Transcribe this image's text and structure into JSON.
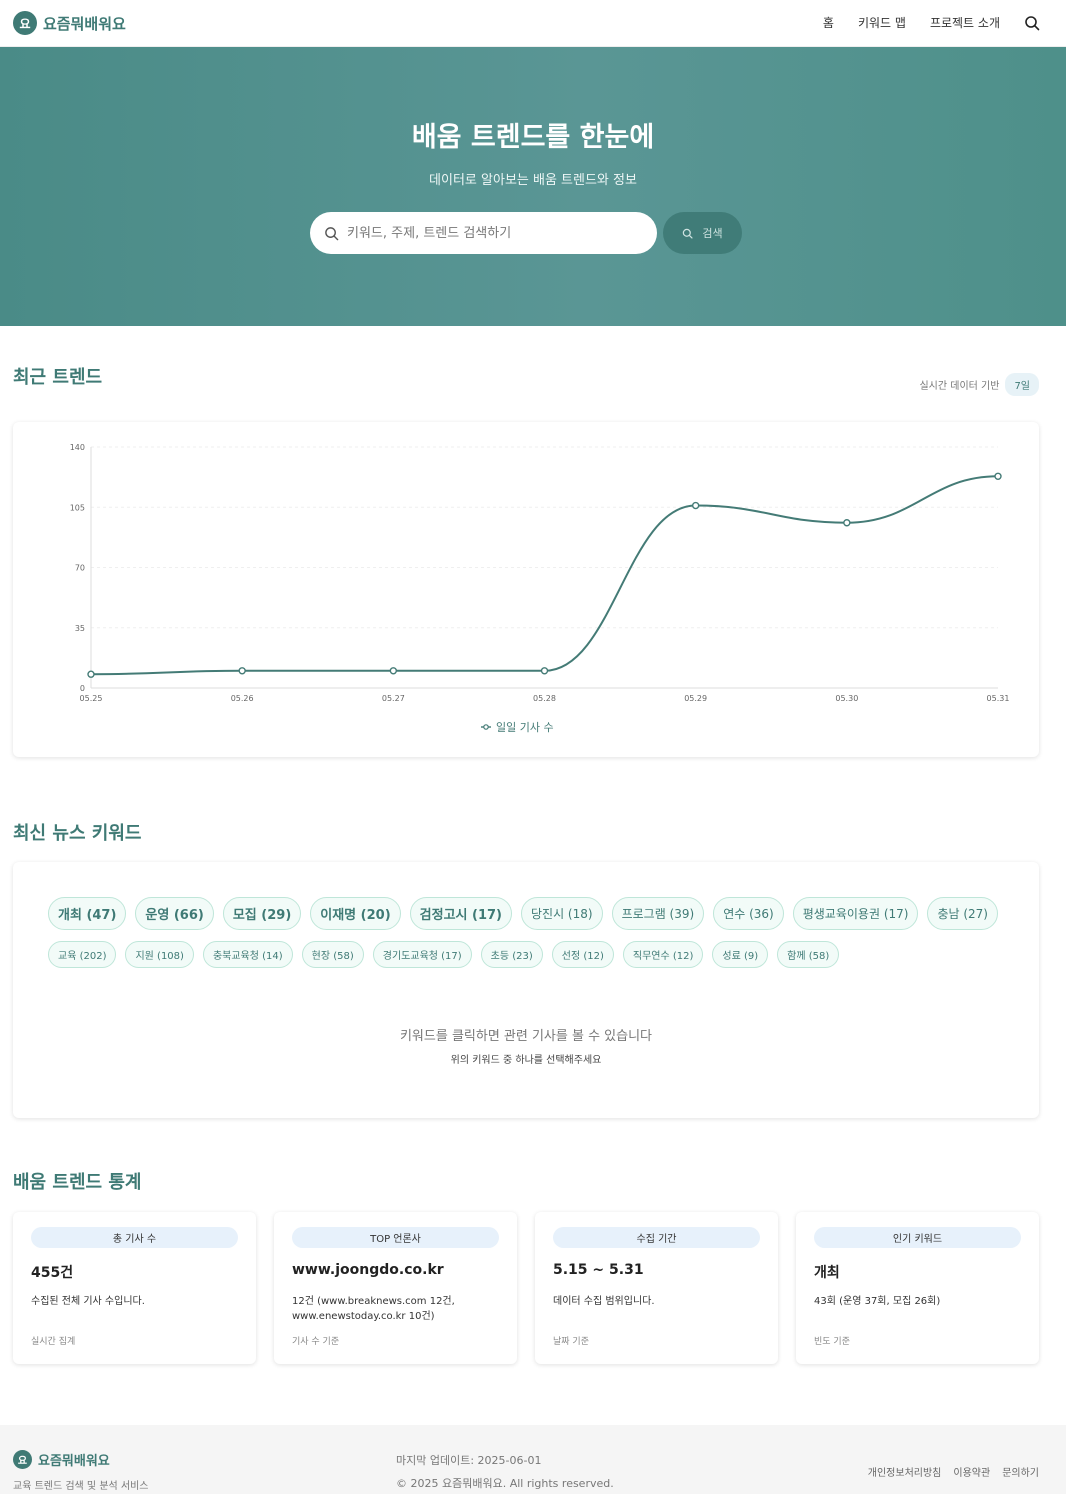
{
  "header": {
    "logo_char": "요",
    "brand": "요즘뭐배워요",
    "nav": [
      "홈",
      "키워드 맵",
      "프로젝트 소개"
    ]
  },
  "hero": {
    "title": "배움 트렌드를 한눈에",
    "subtitle": "데이터로 알아보는 배움 트렌드와 정보",
    "search_placeholder": "키워드, 주제, 트렌드 검색하기",
    "search_button": "검색"
  },
  "trends": {
    "title": "최근 트렌드",
    "meta_text": "실시간 데이터 기반",
    "range": "7일"
  },
  "chart_data": {
    "type": "line",
    "x": [
      "05.25",
      "05.26",
      "05.27",
      "05.28",
      "05.29",
      "05.30",
      "05.31"
    ],
    "series": [
      {
        "name": "일일 기사 수",
        "values": [
          8,
          10,
          10,
          10,
          106,
          96,
          123
        ]
      }
    ],
    "yticks": [
      0,
      35,
      70,
      105,
      140
    ],
    "ylim": [
      0,
      140
    ],
    "grid": true,
    "legend": "bottom",
    "color": "#447b76"
  },
  "keywords": {
    "title": "최신 뉴스 키워드",
    "row1": [
      {
        "label": "개최 (47)",
        "size": "big"
      },
      {
        "label": "운영 (66)",
        "size": "big"
      },
      {
        "label": "모집 (29)",
        "size": "big"
      },
      {
        "label": "이재명 (20)",
        "size": "big"
      },
      {
        "label": "검정고시 (17)",
        "size": "big"
      },
      {
        "label": "당진시 (18)",
        "size": "mid"
      },
      {
        "label": "프로그램 (39)",
        "size": "mid"
      },
      {
        "label": "연수 (36)",
        "size": "mid"
      },
      {
        "label": "평생교육이용권 (17)",
        "size": "mid"
      },
      {
        "label": "충남 (27)",
        "size": "mid"
      }
    ],
    "row2": [
      {
        "label": "교육 (202)",
        "size": "small"
      },
      {
        "label": "지원 (108)",
        "size": "small"
      },
      {
        "label": "충북교육청 (14)",
        "size": "small"
      },
      {
        "label": "현장 (58)",
        "size": "small"
      },
      {
        "label": "경기도교육청 (17)",
        "size": "small"
      },
      {
        "label": "초등 (23)",
        "size": "small"
      },
      {
        "label": "선정 (12)",
        "size": "small"
      },
      {
        "label": "직무연수 (12)",
        "size": "small"
      },
      {
        "label": "성료 (9)",
        "size": "small"
      },
      {
        "label": "함께 (58)",
        "size": "small"
      }
    ],
    "hint_main": "키워드를 클릭하면 관련 기사를 볼 수 있습니다",
    "hint_sub": "위의 키워드 중 하나를 선택해주세요"
  },
  "stats": {
    "title": "배움 트렌드 통계",
    "cards": [
      {
        "badge": "총 기사 수",
        "value": "455건",
        "desc": "수집된 전체 기사 수입니다.",
        "foot": "실시간 집계"
      },
      {
        "badge": "TOP 언론사",
        "value": "www.joongdo.co.kr",
        "desc": "12건 (www.breaknews.com 12건, www.enewstoday.co.kr 10건)",
        "foot": "기사 수 기준"
      },
      {
        "badge": "수집 기간",
        "value": "5.15 ~ 5.31",
        "desc": "데이터 수집 범위입니다.",
        "foot": "날짜 기준"
      },
      {
        "badge": "인기 키워드",
        "value": "개최",
        "desc": "43회 (운영 37회, 모집 26회)",
        "foot": "빈도 기준"
      }
    ]
  },
  "footer": {
    "brand": "요즘뭐배워요",
    "tagline": "교육 트렌드 검색 및 분석 서비스",
    "updated": "마지막 업데이트: 2025-06-01",
    "copyright": "© 2025 요즘뭐배워요. All rights reserved.",
    "links": [
      "개인정보처리방침",
      "이용약관",
      "문의하기"
    ]
  }
}
